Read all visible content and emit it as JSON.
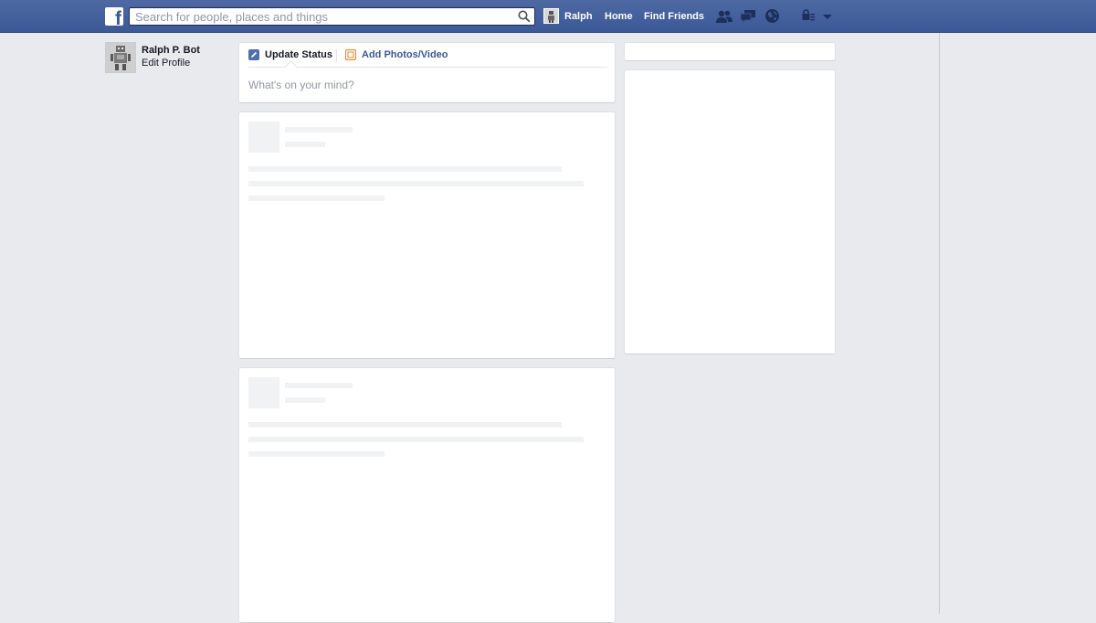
{
  "topbar": {
    "search_placeholder": "Search for people, places and things",
    "user_link": "Ralph",
    "home_link": "Home",
    "find_friends_link": "Find Friends",
    "bar_color": "#3b5998"
  },
  "left_nav": {
    "name": "Ralph P. Bot",
    "edit_profile": "Edit Profile"
  },
  "composer": {
    "tabs": [
      {
        "label": "Update Status",
        "icon": "pencil-icon"
      },
      {
        "label": "Add Photos/Video",
        "icon": "photo-icon"
      }
    ],
    "placeholder": "What's on your mind?"
  }
}
